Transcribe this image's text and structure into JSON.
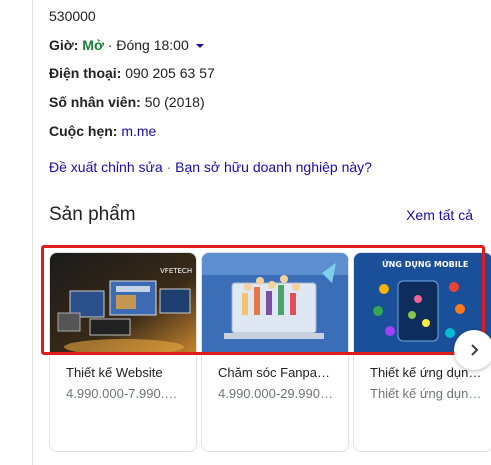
{
  "info": {
    "postal_code": "530000",
    "hours_label": "Giờ:",
    "hours_status": "Mở",
    "hours_close": "· Đóng 18:00",
    "phone_label": "Điện thoại:",
    "phone_value": "090 205 63 57",
    "staff_label": "Số nhân viên:",
    "staff_value": "50 (2018)",
    "appointment_label": "Cuộc hẹn:",
    "appointment_value": "m.me"
  },
  "suggest": {
    "edit": "Đề xuất chỉnh sửa",
    "separator": "·",
    "own": "Bạn sở hữu doanh nghiệp này?"
  },
  "products": {
    "title": "Sản phẩm",
    "see_all": "Xem tất cả",
    "items": [
      {
        "name": "Thiết kế Website",
        "price": "4.990.000-7.990.…",
        "image_caption": "VFETECH"
      },
      {
        "name": "Chăm sóc Fanpa…",
        "price": "4.990.000-29.990.…",
        "image_caption": ""
      },
      {
        "name": "Thiết kế ứng dụng…",
        "price": "Thiết kế ứng dụn…",
        "image_caption": "ỨNG DỤNG MOBILE"
      }
    ]
  },
  "colors": {
    "link": "#1a0dab",
    "open": "#188038",
    "highlight": "#e21b1b"
  },
  "icons": [
    "caret-down-icon",
    "chevron-right-icon"
  ]
}
